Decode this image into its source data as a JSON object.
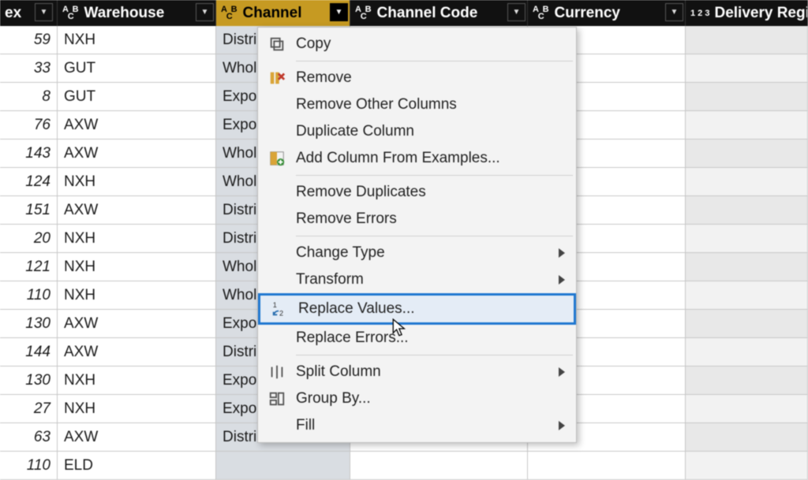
{
  "columns": {
    "index_partial": "ex",
    "warehouse": "Warehouse",
    "channel": "Channel",
    "channel_code": "Channel Code",
    "currency": "Currency",
    "delivery_region_partial": "Delivery Region"
  },
  "type_labels": {
    "abc_top": "A B",
    "abc_bottom": "C",
    "num": "1 2 3"
  },
  "rows": [
    {
      "idx": "59",
      "wh": "NXH",
      "ch": "Distril"
    },
    {
      "idx": "33",
      "wh": "GUT",
      "ch": "Whole"
    },
    {
      "idx": "8",
      "wh": "GUT",
      "ch": "Expor"
    },
    {
      "idx": "76",
      "wh": "AXW",
      "ch": "Expor"
    },
    {
      "idx": "143",
      "wh": "AXW",
      "ch": "Whole"
    },
    {
      "idx": "124",
      "wh": "NXH",
      "ch": "Whole"
    },
    {
      "idx": "151",
      "wh": "AXW",
      "ch": "Distril"
    },
    {
      "idx": "20",
      "wh": "NXH",
      "ch": "Distril"
    },
    {
      "idx": "121",
      "wh": "NXH",
      "ch": "Whole"
    },
    {
      "idx": "110",
      "wh": "NXH",
      "ch": "Whole"
    },
    {
      "idx": "130",
      "wh": "AXW",
      "ch": "Expor"
    },
    {
      "idx": "144",
      "wh": "AXW",
      "ch": "Distril"
    },
    {
      "idx": "130",
      "wh": "NXH",
      "ch": "Expor"
    },
    {
      "idx": "27",
      "wh": "NXH",
      "ch": "Expor"
    },
    {
      "idx": "63",
      "wh": "AXW",
      "ch": "Distril"
    },
    {
      "idx": "110",
      "wh": "ELD",
      "ch": ""
    }
  ],
  "menu": {
    "copy": "Copy",
    "remove": "Remove",
    "remove_other": "Remove Other Columns",
    "duplicate": "Duplicate Column",
    "add_examples": "Add Column From Examples...",
    "remove_dupes": "Remove Duplicates",
    "remove_errors": "Remove Errors",
    "change_type": "Change Type",
    "transform": "Transform",
    "replace_values": "Replace Values...",
    "replace_errors": "Replace Errors...",
    "split_column": "Split Column",
    "group_by": "Group By...",
    "fill": "Fill"
  }
}
